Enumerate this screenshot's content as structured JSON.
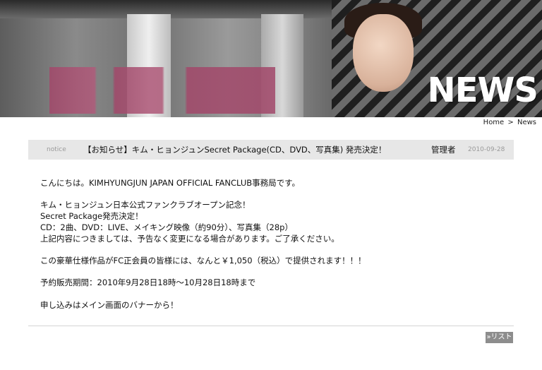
{
  "banner": {
    "heading": "NEWS"
  },
  "breadcrumb": {
    "home": "Home",
    "separator": ">",
    "current": "News"
  },
  "post": {
    "category": "notice",
    "title": "【お知らせ】キム・ヒョンジュンSecret Package(CD、DVD、写真集) 発売決定！",
    "author": "管理者",
    "date": "2010-09-28"
  },
  "body": {
    "lines": [
      "こんにちは。KIMHYUNGJUN JAPAN OFFICIAL FANCLUB事務局です。",
      "",
      "キム・ヒョンジュン日本公式ファンクラブオープン記念！",
      "Secret Package発売決定！",
      "CD：2曲、DVD：LIVE、メイキング映像（約90分）、写真集（28p）",
      "上記内容につきましては、予告なく変更になる場合があります。ご了承ください。",
      "",
      "この豪華仕様作品がFC正会員の皆様には、なんと￥1,050（税込）で提供されます！！！",
      "",
      "予約販売期間：2010年9月28日18時～10月28日18時まで",
      "",
      "申し込みはメイン画面のバナーから！"
    ]
  },
  "footer": {
    "list_button": "»リスト"
  }
}
